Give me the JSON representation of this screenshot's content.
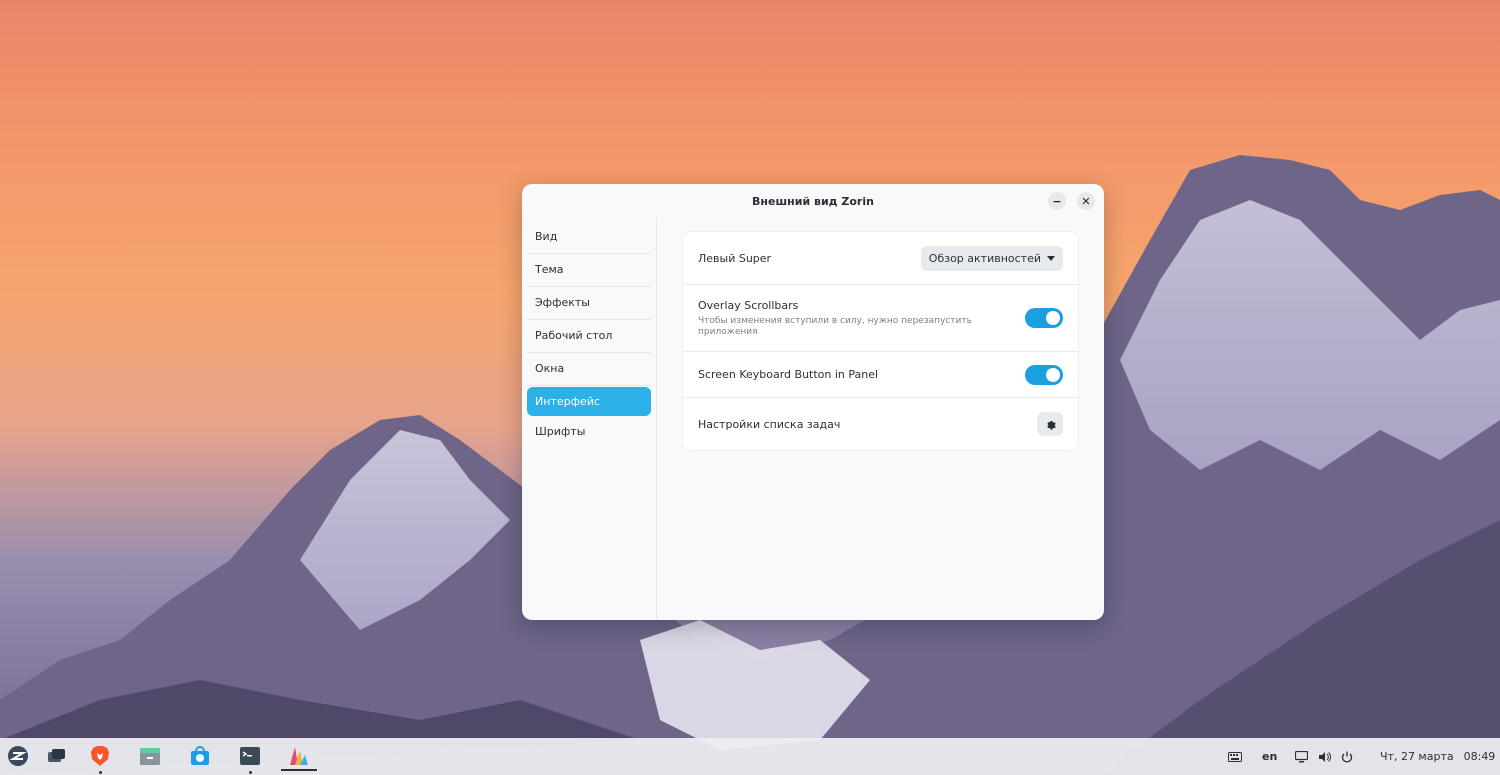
{
  "window": {
    "title": "Внешний вид Zorin",
    "minimize_label": "−",
    "close_label": "✕"
  },
  "sidebar": {
    "items": [
      {
        "label": "Вид"
      },
      {
        "label": "Тема"
      },
      {
        "label": "Эффекты"
      },
      {
        "label": "Рабочий стол"
      },
      {
        "label": "Окна"
      },
      {
        "label": "Интерфейс",
        "active": true
      },
      {
        "label": "Шрифты"
      }
    ]
  },
  "settings": {
    "left_super": {
      "label": "Левый Super",
      "value": "Обзор активностей"
    },
    "overlay_scrollbars": {
      "label": "Overlay Scrollbars",
      "hint": "Чтобы изменения вступили в силу, нужно перезапустить приложения",
      "enabled": true
    },
    "screen_keyboard": {
      "label": "Screen Keyboard Button in Panel",
      "enabled": true
    },
    "taskbar_settings": {
      "label": "Настройки списка задач"
    }
  },
  "taskbar": {
    "language": "en",
    "date": "Чт, 27 марта",
    "time": "08:49"
  },
  "colors": {
    "accent": "#2bb0e8",
    "toggle_on": "#1a9fe0"
  }
}
